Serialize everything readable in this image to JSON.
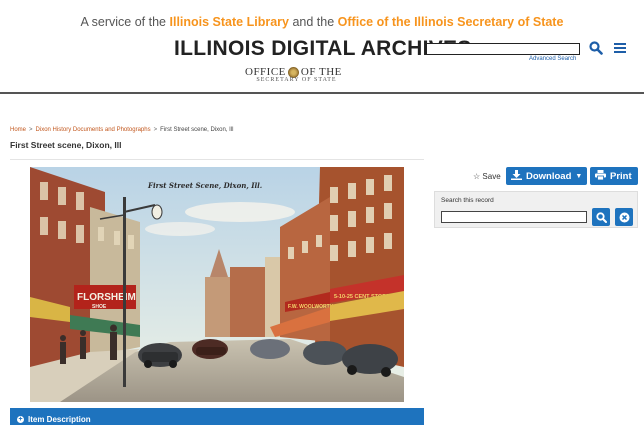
{
  "header": {
    "tagline_prefix": "A service of the",
    "tagline_link1": "Illinois State Library",
    "tagline_mid": "and the",
    "tagline_link2": "Office of the Illinois Secretary of State",
    "site_title": "ILLINOIS DIGITAL ARCHIVES",
    "search_value": "",
    "advanced_search": "Advanced Search",
    "logo_line1_a": "OFFICE",
    "logo_line1_b": "OF THE",
    "logo_line2": "SECRETARY OF STATE"
  },
  "breadcrumb": {
    "home": "Home",
    "collection": "Dixon History Documents and Photographs",
    "current": "First Street scene, Dixon, Ill",
    "separator": ">"
  },
  "record": {
    "title": "First Street scene, Dixon, Ill",
    "image_caption": "First Street Scene, Dixon, Ill.",
    "sign_florsheim": "FLORSHEIM",
    "sign_shoe": "SHOE",
    "sign_woolworth": "F.W. WOOLWORTH CO.",
    "sign_dime": "5-10-25 CENT STORE"
  },
  "actions": {
    "save": "Save",
    "download": "Download",
    "print": "Print"
  },
  "search_record": {
    "label": "Search this record",
    "value": ""
  },
  "item_description": {
    "label": "Item Description"
  },
  "colors": {
    "accent_blue": "#1e73be",
    "tagline_orange": "#f7941d",
    "breadcrumb_link": "#c2571d"
  }
}
